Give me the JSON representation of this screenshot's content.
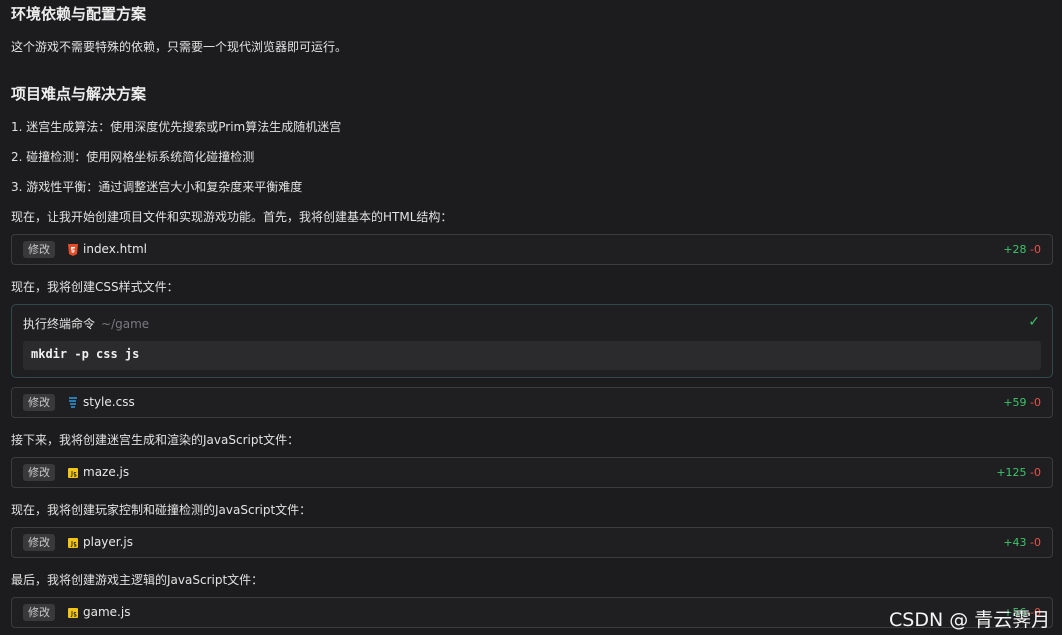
{
  "sections": [
    {
      "title": "环境依赖与配置方案",
      "text": "这个游戏不需要特殊的依赖，只需要一个现代浏览器即可运行。"
    },
    {
      "title": "项目难点与解决方案"
    }
  ],
  "difficulties": [
    "1. 迷宫生成算法：使用深度优先搜索或Prim算法生成随机迷宫",
    "2. 碰撞检测：使用网格坐标系统简化碰撞检测",
    "3. 游戏性平衡：通过调整迷宫大小和复杂度来平衡难度"
  ],
  "messages": {
    "m1": "现在，让我开始创建项目文件和实现游戏功能。首先，我将创建基本的HTML结构：",
    "m2": "现在，我将创建CSS样式文件：",
    "m3": "接下来，我将创建迷宫生成和渲染的JavaScript文件：",
    "m4": "现在，我将创建玩家控制和碰撞检测的JavaScript文件：",
    "m5": "最后，我将创建游戏主逻辑的JavaScript文件："
  },
  "files": [
    {
      "badge": "修改",
      "name": "index.html",
      "icon": "html5-icon",
      "add": "+28",
      "del": "-0"
    },
    {
      "badge": "修改",
      "name": "style.css",
      "icon": "css3-icon",
      "add": "+59",
      "del": "-0"
    },
    {
      "badge": "修改",
      "name": "maze.js",
      "icon": "js-icon",
      "add": "+125",
      "del": "-0"
    },
    {
      "badge": "修改",
      "name": "player.js",
      "icon": "js-icon",
      "add": "+43",
      "del": "-0"
    },
    {
      "badge": "修改",
      "name": "game.js",
      "icon": "js-icon",
      "add": "+56",
      "del": "-0"
    }
  ],
  "terminal": {
    "title": "执行终端命令",
    "path": "~/game",
    "command": "mkdir -p css js",
    "status_icon": "check-icon"
  },
  "watermark": "CSDN @ 青云霁月",
  "colors": {
    "added": "#3cc46a",
    "removed": "#e5534b",
    "html": "#e34c26",
    "css": "#2b9be3",
    "js": "#f0c419"
  }
}
